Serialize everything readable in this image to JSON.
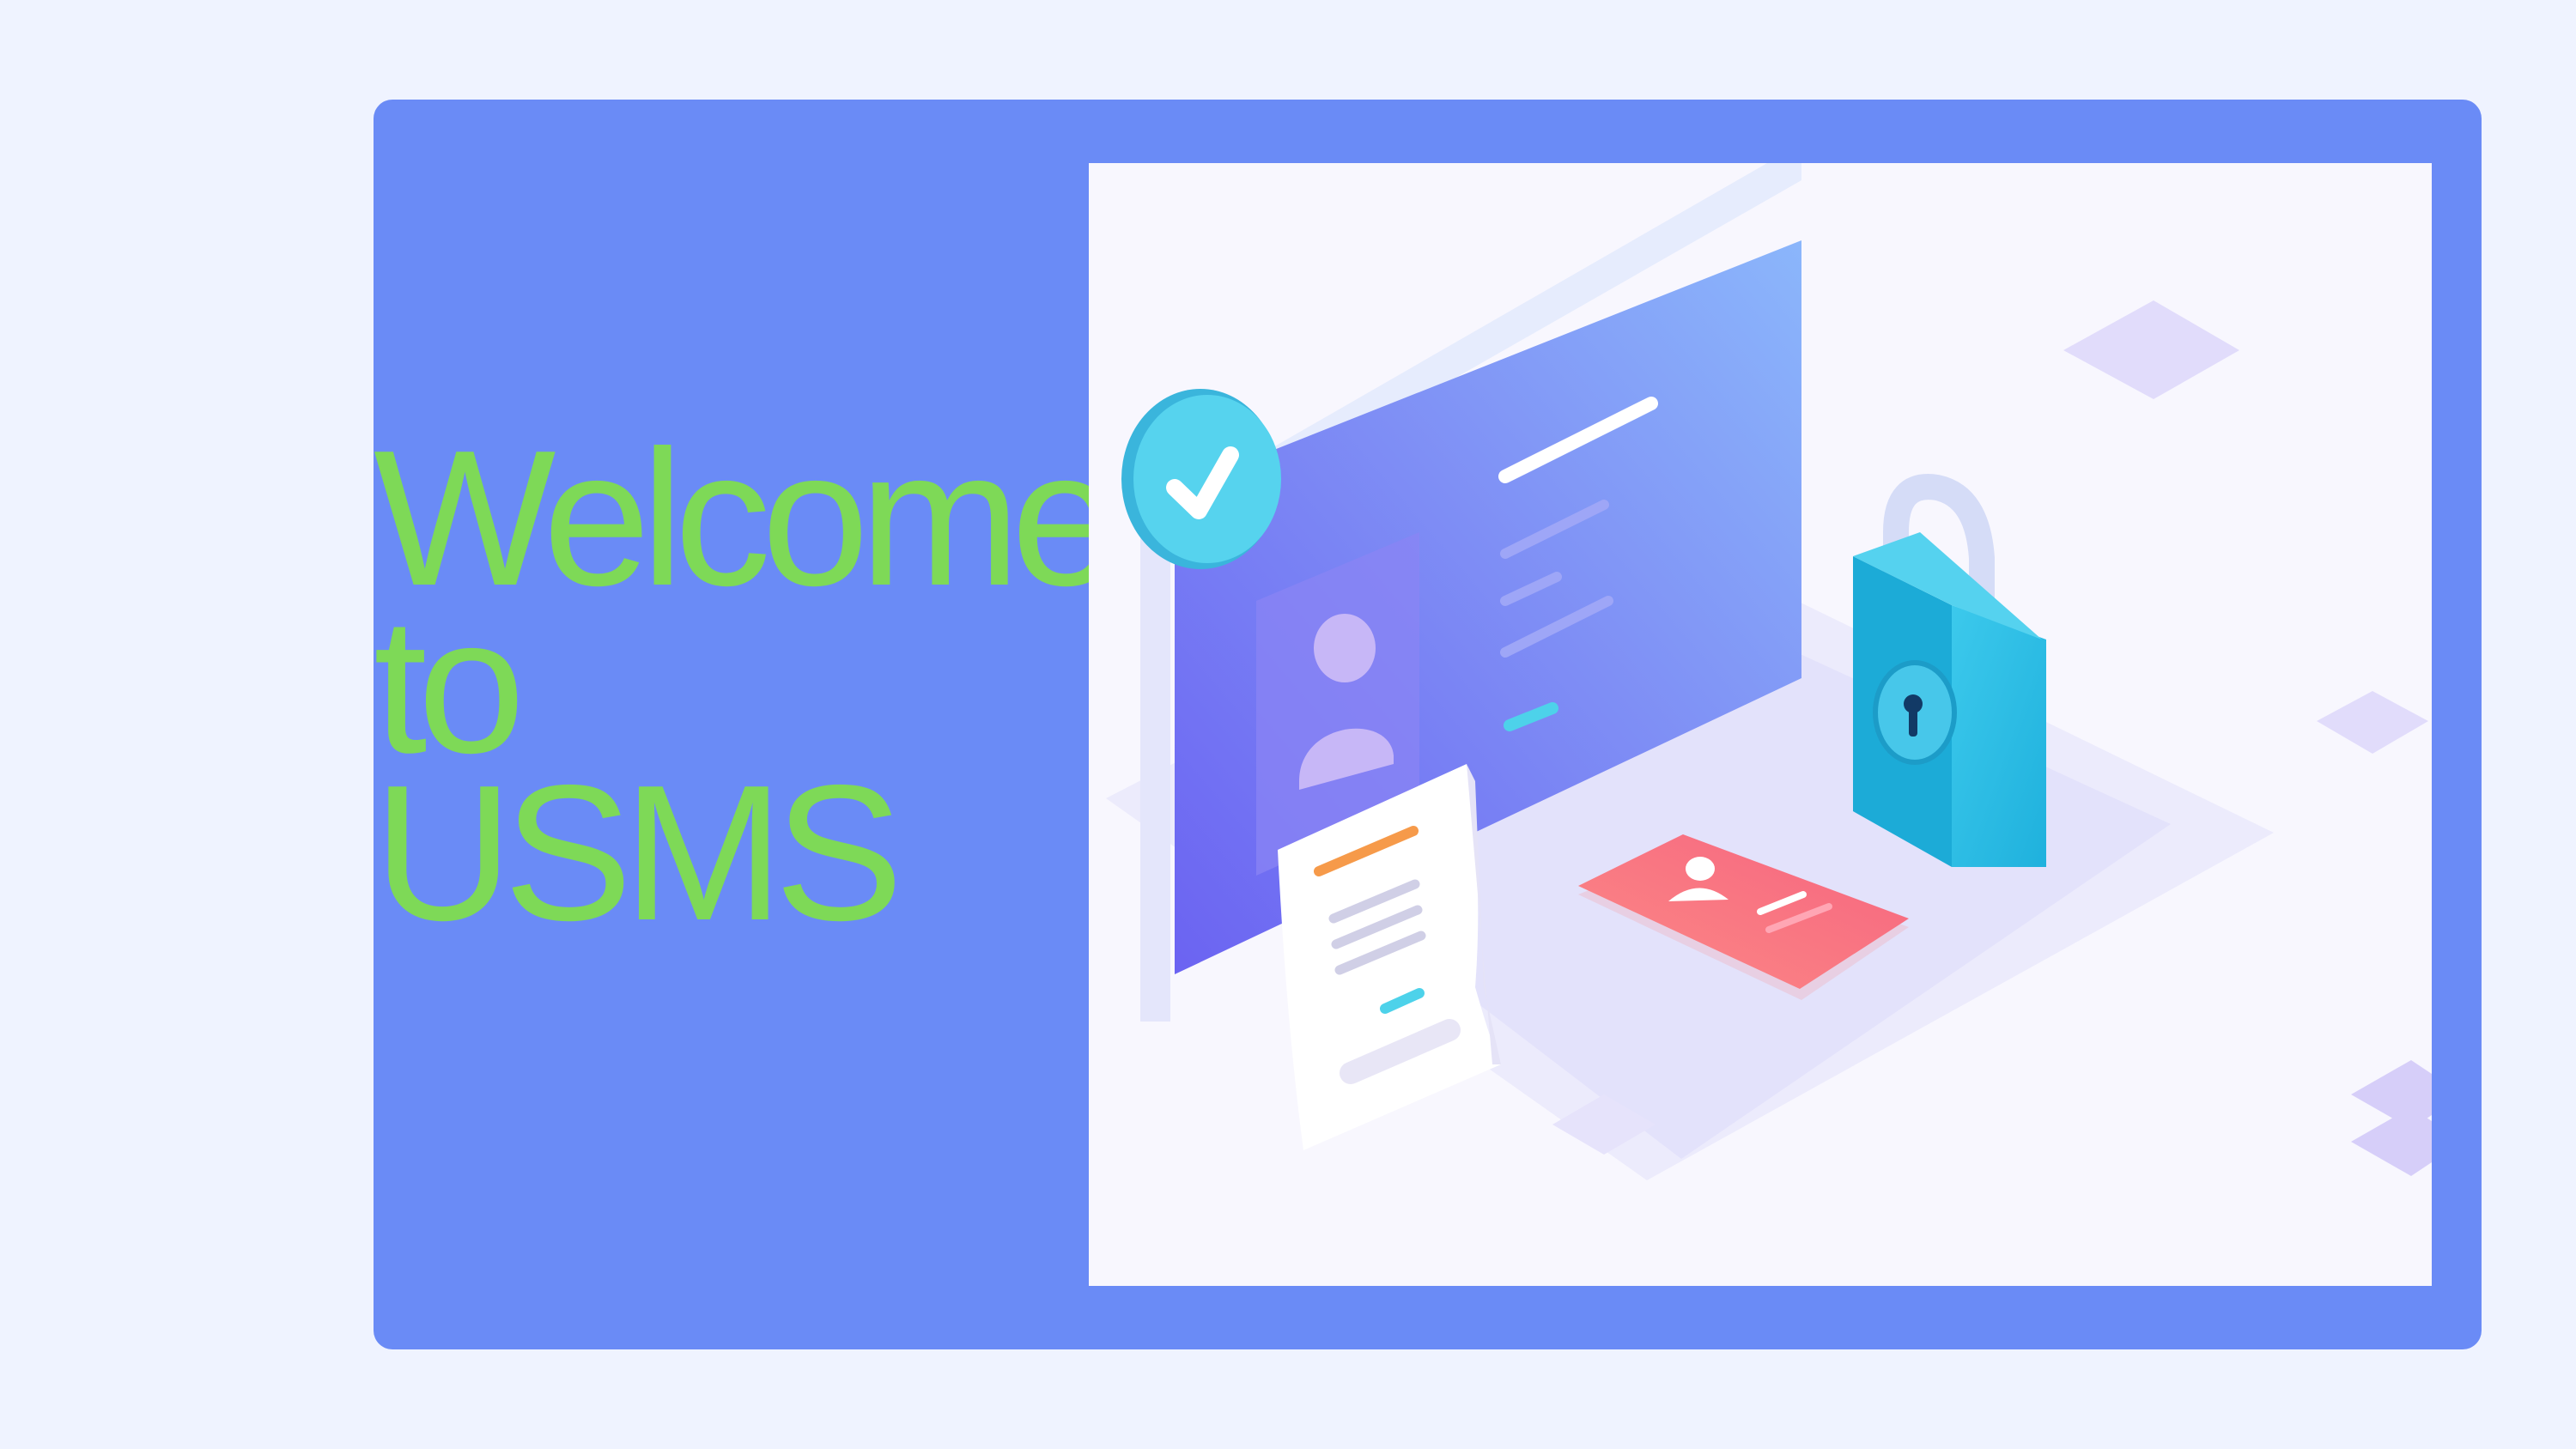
{
  "hero": {
    "title_lines": [
      "Welcome",
      "to",
      "USMS"
    ]
  },
  "illustration": {
    "icons": [
      "security-illustration",
      "check-badge-icon",
      "user-profile-icon",
      "padlock-icon",
      "id-card-icon",
      "document-icon"
    ]
  },
  "colors": {
    "page_background": "#eff3ff",
    "card_background": "#6a8bf6",
    "title_text": "#7ed957",
    "illustration_background": "#f8f7fe",
    "padlock": "#29b9e0",
    "id_card": "#f96f85",
    "check_badge": "#4fd1ec"
  }
}
